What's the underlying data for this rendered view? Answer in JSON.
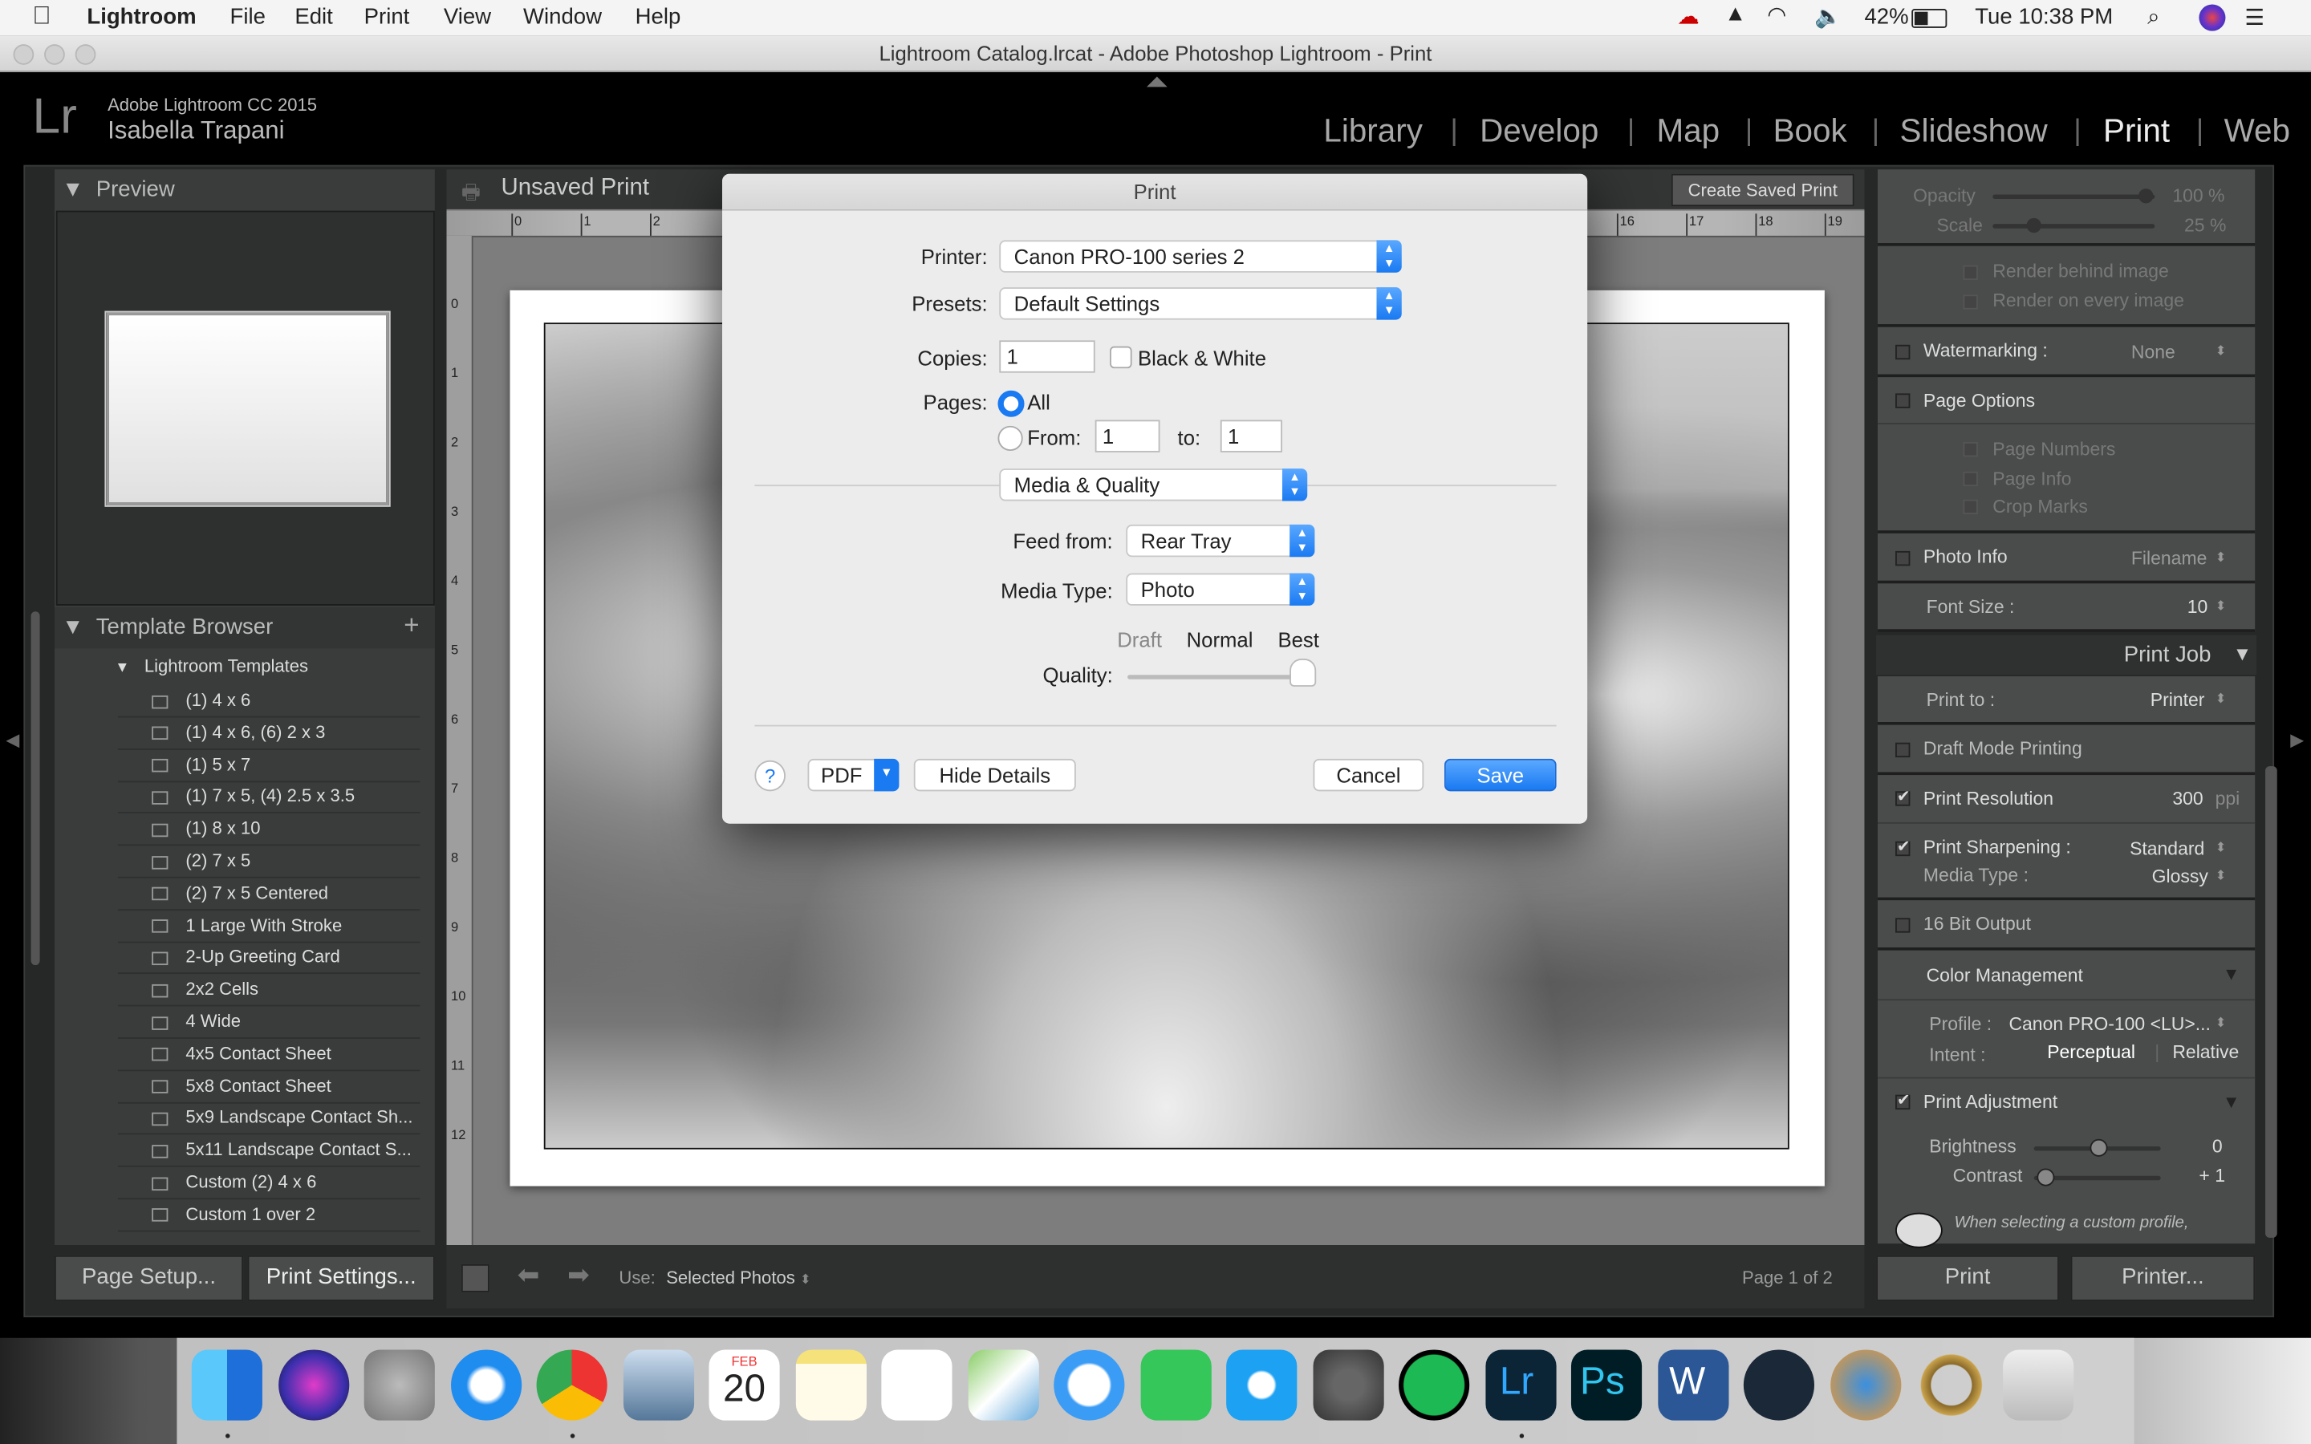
{
  "menubar": {
    "app": "Lightroom",
    "items": [
      "File",
      "Edit",
      "Print",
      "View",
      "Window",
      "Help"
    ],
    "battery": "42%",
    "clock": "Tue 10:38 PM"
  },
  "window": {
    "title": "Lightroom Catalog.lrcat - Adobe Photoshop Lightroom - Print"
  },
  "identity": {
    "product": "Adobe Lightroom CC 2015",
    "user": "Isabella Trapani",
    "logo": "Lr"
  },
  "modules": [
    {
      "label": "Library"
    },
    {
      "label": "Develop"
    },
    {
      "label": "Map"
    },
    {
      "label": "Book"
    },
    {
      "label": "Slideshow"
    },
    {
      "label": "Print",
      "active": true
    },
    {
      "label": "Web"
    }
  ],
  "left": {
    "preview_title": "Preview",
    "template_title": "Template Browser",
    "add": "+",
    "folder": "Lightroom Templates",
    "templates": [
      "(1) 4 x 6",
      "(1) 4 x 6, (6) 2 x 3",
      "(1) 5 x 7",
      "(1) 7 x 5, (4) 2.5 x 3.5",
      "(1) 8 x 10",
      "(2) 7 x 5",
      "(2) 7 x 5 Centered",
      "1 Large With Stroke",
      "2-Up Greeting Card",
      "2x2 Cells",
      "4 Wide",
      "4x5 Contact Sheet",
      "5x8 Contact Sheet",
      "5x9 Landscape Contact Sh...",
      "5x11 Landscape Contact S...",
      "Custom (2) 4 x 6",
      "Custom 1 over 2"
    ],
    "page_setup": "Page Setup...",
    "print_settings": "Print Settings..."
  },
  "center": {
    "title": "Unsaved Print",
    "create_saved": "Create Saved Print",
    "ruler_top": [
      "0",
      "1",
      "2",
      "16",
      "17",
      "18",
      "19"
    ],
    "ruler_left": [
      "0",
      "1",
      "2",
      "3",
      "4",
      "5",
      "6",
      "7",
      "8",
      "9",
      "10",
      "11",
      "12"
    ],
    "use_label": "Use:",
    "use_value": "Selected Photos",
    "page_info": "Page 1 of 2"
  },
  "right": {
    "opacity": {
      "label": "Opacity",
      "value": "100",
      "unit": "%",
      "fraction": 1.0
    },
    "scale": {
      "label": "Scale",
      "value": "25",
      "unit": "%",
      "fraction": 0.25
    },
    "render_behind": "Render behind image",
    "render_every": "Render on every image",
    "watermarking": {
      "label": "Watermarking :",
      "value": "None"
    },
    "page_options": "Page Options",
    "page_numbers": "Page Numbers",
    "page_info": "Page Info",
    "crop_marks": "Crop Marks",
    "photo_info": {
      "label": "Photo Info",
      "value": "Filename"
    },
    "font_size": {
      "label": "Font Size :",
      "value": "10"
    },
    "print_job": "Print Job",
    "print_to": {
      "label": "Print to :",
      "value": "Printer"
    },
    "draft": "Draft Mode Printing",
    "resolution": {
      "label": "Print Resolution",
      "value": "300",
      "unit": "ppi"
    },
    "sharpening": {
      "label": "Print Sharpening :",
      "value": "Standard"
    },
    "media_type": {
      "label": "Media Type :",
      "value": "Glossy"
    },
    "bit16": "16 Bit Output",
    "color_mgmt": "Color Management",
    "profile": {
      "label": "Profile :",
      "value": "Canon PRO-100 <LU>..."
    },
    "intent": {
      "label": "Intent :",
      "perceptual": "Perceptual",
      "relative": "Relative"
    },
    "adjust": "Print Adjustment",
    "brightness": {
      "label": "Brightness",
      "value": "0"
    },
    "contrast": {
      "label": "Contrast",
      "value": "+ 1"
    },
    "warning": "When selecting a custom profile,",
    "print_btn": "Print",
    "printer_btn": "Printer..."
  },
  "dialog": {
    "title": "Print",
    "printer_label": "Printer:",
    "printer": "Canon PRO-100 series 2",
    "presets_label": "Presets:",
    "presets": "Default Settings",
    "copies_label": "Copies:",
    "copies": "1",
    "bw": "Black & White",
    "pages_label": "Pages:",
    "all": "All",
    "from": "From:",
    "from_val": "1",
    "to": "to:",
    "to_val": "1",
    "section": "Media & Quality",
    "feed_label": "Feed from:",
    "feed": "Rear Tray",
    "media_label": "Media Type:",
    "media": "Photo",
    "draft": "Draft",
    "normal": "Normal",
    "best": "Best",
    "quality_label": "Quality:",
    "quality_level": "Best",
    "help": "?",
    "pdf": "PDF",
    "hide": "Hide Details",
    "cancel": "Cancel",
    "save": "Save",
    "accent": "#1a7af2"
  },
  "dock": {
    "calendar_month": "FEB",
    "calendar_day": "20",
    "apps": [
      "Finder",
      "Siri",
      "Launchpad",
      "Safari",
      "Chrome",
      "Preview",
      "Calendar",
      "Notes",
      "Reminders",
      "Maps",
      "Messages",
      "FaceTime",
      "App Store",
      "System Preferences",
      "Spotify",
      "Lightroom",
      "Photoshop",
      "Word",
      "Steam",
      "Location",
      "Ring",
      "Trash"
    ]
  }
}
